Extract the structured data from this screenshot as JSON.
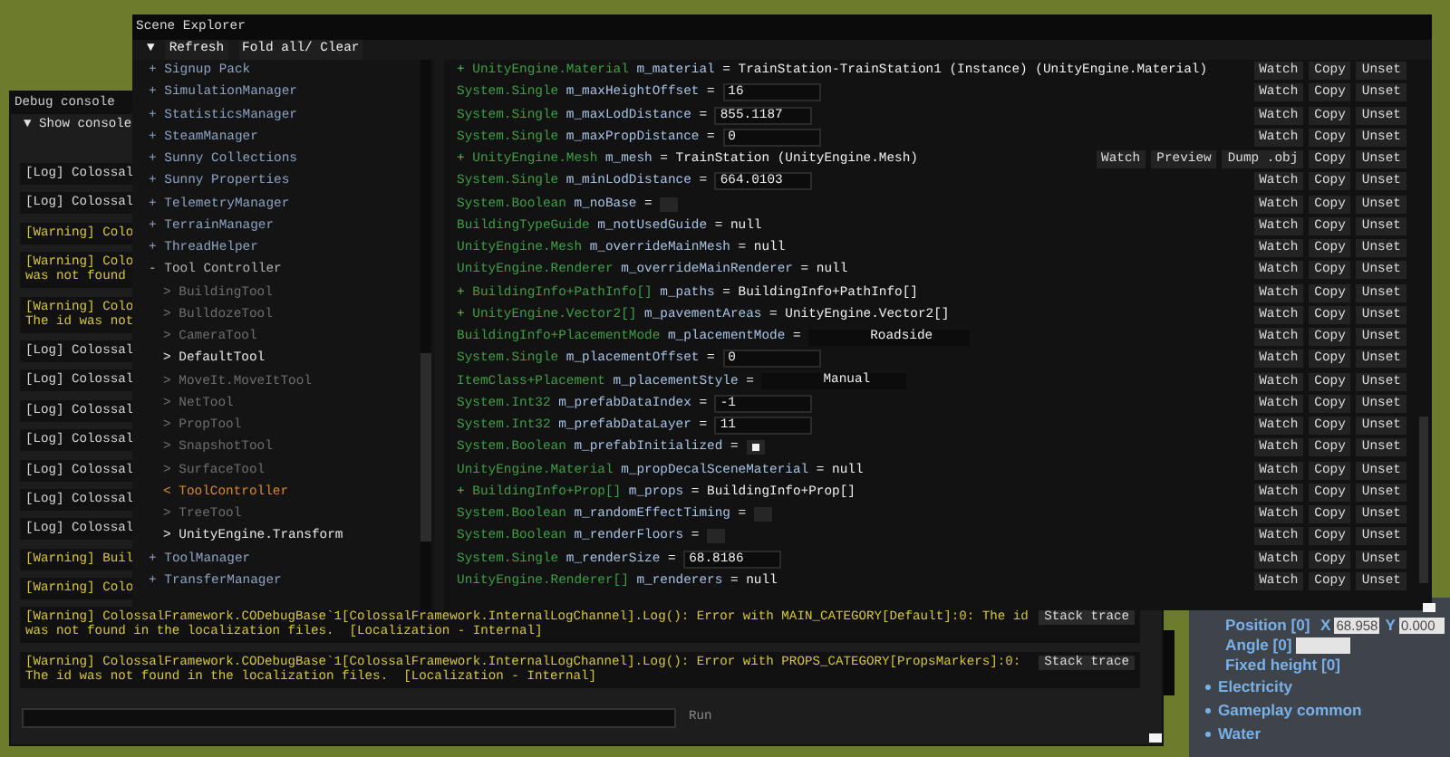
{
  "debug_console": {
    "title": "Debug console",
    "toggle": {
      "marker": "▼",
      "label": "Show console"
    },
    "entries": [
      {
        "kind": "log",
        "lines": [
          "[Log] Colossal"
        ]
      },
      {
        "kind": "log",
        "lines": [
          "[Log] Colossal"
        ]
      },
      {
        "kind": "warning",
        "lines": [
          "[Warning] Colo"
        ]
      },
      {
        "kind": "warning",
        "lines": [
          "[Warning] Colo",
          "was not found"
        ]
      },
      {
        "kind": "warning",
        "lines": [
          "[Warning] Colo",
          "The id was not"
        ]
      },
      {
        "kind": "log",
        "lines": [
          "[Log] Colossal"
        ]
      },
      {
        "kind": "log",
        "lines": [
          "[Log] Colossal"
        ]
      },
      {
        "kind": "log",
        "lines": [
          "[Log] Colossal"
        ]
      },
      {
        "kind": "log",
        "lines": [
          "[Log] Colossal"
        ]
      },
      {
        "kind": "log",
        "lines": [
          "[Log] Colossal"
        ]
      },
      {
        "kind": "log",
        "lines": [
          "[Log] Colossal"
        ]
      },
      {
        "kind": "log",
        "lines": [
          "[Log] Colossal"
        ]
      },
      {
        "kind": "warning",
        "lines": [
          "[Warning] Buil"
        ]
      },
      {
        "kind": "warning",
        "lines": [
          "[Warning] Colo"
        ]
      },
      {
        "kind": "warning",
        "lines": [
          "[Warning] ColossalFramework.CODebugBase`1[ColossalFramework.InternalLogChannel].Log(): Error with MAIN_CATEGORY[Default]:0: The id",
          "was not found in the localization files.  [Localization - Internal]"
        ],
        "action": "Stack trace"
      },
      {
        "kind": "warning",
        "lines": [
          "[Warning] ColossalFramework.CODebugBase`1[ColossalFramework.InternalLogChannel].Log(): Error with PROPS_CATEGORY[PropsMarkers]:0:",
          "The id was not found in the localization files.  [Localization - Internal]"
        ],
        "action": "Stack trace"
      }
    ],
    "run_button": "Run"
  },
  "scene_explorer": {
    "title": "Scene Explorer",
    "toolbar": {
      "marker": "▼",
      "buttons": [
        "Refresh",
        "Fold all/ Clear"
      ]
    },
    "tree": [
      {
        "marker": "+",
        "label": "Signup Pack"
      },
      {
        "marker": "+",
        "label": "SimulationManager"
      },
      {
        "marker": "+",
        "label": "StatisticsManager"
      },
      {
        "marker": "+",
        "label": "SteamManager"
      },
      {
        "marker": "+",
        "label": "Sunny Collections"
      },
      {
        "marker": "+",
        "label": "Sunny Properties"
      },
      {
        "marker": "+",
        "label": "TelemetryManager"
      },
      {
        "marker": "+",
        "label": "TerrainManager"
      },
      {
        "marker": "+",
        "label": "ThreadHelper"
      },
      {
        "marker": "-",
        "label": "Tool Controller",
        "children": [
          {
            "marker": ">",
            "label": "BuildingTool",
            "kind": "inactive"
          },
          {
            "marker": ">",
            "label": "BulldozeTool",
            "kind": "inactive"
          },
          {
            "marker": ">",
            "label": "CameraTool",
            "kind": "inactive"
          },
          {
            "marker": ">",
            "label": "DefaultTool",
            "kind": "active"
          },
          {
            "marker": ">",
            "label": "MoveIt.MoveItTool",
            "kind": "inactive"
          },
          {
            "marker": ">",
            "label": "NetTool",
            "kind": "inactive"
          },
          {
            "marker": ">",
            "label": "PropTool",
            "kind": "inactive"
          },
          {
            "marker": ">",
            "label": "SnapshotTool",
            "kind": "inactive"
          },
          {
            "marker": ">",
            "label": "SurfaceTool",
            "kind": "inactive"
          },
          {
            "marker": "<",
            "label": "ToolController",
            "kind": "current"
          },
          {
            "marker": ">",
            "label": "TreeTool",
            "kind": "inactive"
          },
          {
            "marker": ">",
            "label": "UnityEngine.Transform",
            "kind": "active"
          }
        ]
      },
      {
        "marker": "+",
        "label": "ToolManager"
      },
      {
        "marker": "+",
        "label": "TransferManager"
      }
    ],
    "properties": [
      {
        "kind": "text",
        "marker": "+",
        "type": "UnityEngine.Material",
        "name": "m_material",
        "sep": "=",
        "value": "TrainStation-TrainStation1 (Instance) (UnityEngine.Material)",
        "buttons": [
          "Watch",
          "Copy",
          "Unset"
        ]
      },
      {
        "kind": "field",
        "type": "System.Single",
        "name": "m_maxHeightOffset",
        "sep": "=",
        "value": "16",
        "buttons": [
          "Watch",
          "Copy",
          "Unset"
        ]
      },
      {
        "kind": "field",
        "type": "System.Single",
        "name": "m_maxLodDistance",
        "sep": "=",
        "value": "855.1187",
        "buttons": [
          "Watch",
          "Copy",
          "Unset"
        ]
      },
      {
        "kind": "field",
        "type": "System.Single",
        "name": "m_maxPropDistance",
        "sep": "=",
        "value": "0",
        "buttons": [
          "Watch",
          "Copy",
          "Unset"
        ]
      },
      {
        "kind": "text",
        "marker": "+",
        "type": "UnityEngine.Mesh",
        "name": "m_mesh",
        "sep": "=",
        "value": "TrainStation (UnityEngine.Mesh)",
        "buttons": [
          "Watch",
          "Preview",
          "Dump .obj",
          "Copy",
          "Unset"
        ]
      },
      {
        "kind": "field",
        "type": "System.Single",
        "name": "m_minLodDistance",
        "sep": "=",
        "value": "664.0103",
        "buttons": [
          "Watch",
          "Copy",
          "Unset"
        ]
      },
      {
        "kind": "toggle",
        "type": "System.Boolean",
        "name": "m_noBase",
        "sep": "=",
        "checked": false,
        "buttons": [
          "Watch",
          "Copy",
          "Unset"
        ]
      },
      {
        "kind": "text",
        "type": "BuildingTypeGuide",
        "name": "m_notUsedGuide",
        "sep": "=",
        "value": "null",
        "buttons": [
          "Watch",
          "Copy",
          "Unset"
        ]
      },
      {
        "kind": "text",
        "type": "UnityEngine.Mesh",
        "name": "m_overrideMainMesh",
        "sep": "=",
        "value": "null",
        "buttons": [
          "Watch",
          "Copy",
          "Unset"
        ]
      },
      {
        "kind": "text",
        "type": "UnityEngine.Renderer",
        "name": "m_overrideMainRenderer",
        "sep": "=",
        "value": "null",
        "buttons": [
          "Watch",
          "Copy",
          "Unset"
        ]
      },
      {
        "kind": "text",
        "marker": "+",
        "type": "BuildingInfo+PathInfo[]",
        "name": "m_paths",
        "sep": "=",
        "value": "BuildingInfo+PathInfo[]",
        "buttons": [
          "Watch",
          "Copy",
          "Unset"
        ]
      },
      {
        "kind": "text",
        "marker": "+",
        "type": "UnityEngine.Vector2[]",
        "name": "m_pavementAreas",
        "sep": "=",
        "value": "UnityEngine.Vector2[]",
        "buttons": [
          "Watch",
          "Copy",
          "Unset"
        ]
      },
      {
        "kind": "enum",
        "type": "BuildingInfo+PlacementMode",
        "name": "m_placementMode",
        "sep": "=",
        "value": "Roadside",
        "buttons": [
          "Watch",
          "Copy",
          "Unset"
        ]
      },
      {
        "kind": "field",
        "type": "System.Single",
        "name": "m_placementOffset",
        "sep": "=",
        "value": "0",
        "buttons": [
          "Watch",
          "Copy",
          "Unset"
        ]
      },
      {
        "kind": "enum",
        "type": "ItemClass+Placement",
        "name": "m_placementStyle",
        "sep": "=",
        "value": "Manual",
        "buttons": [
          "Watch",
          "Copy",
          "Unset"
        ]
      },
      {
        "kind": "field",
        "type": "System.Int32",
        "name": "m_prefabDataIndex",
        "sep": "=",
        "value": "-1",
        "buttons": [
          "Watch",
          "Copy",
          "Unset"
        ]
      },
      {
        "kind": "field",
        "type": "System.Int32",
        "name": "m_prefabDataLayer",
        "sep": "=",
        "value": "11",
        "buttons": [
          "Watch",
          "Copy",
          "Unset"
        ]
      },
      {
        "kind": "toggle",
        "type": "System.Boolean",
        "name": "m_prefabInitialized",
        "sep": "=",
        "checked": true,
        "buttons": [
          "Watch",
          "Copy",
          "Unset"
        ]
      },
      {
        "kind": "text",
        "type": "UnityEngine.Material",
        "name": "m_propDecalSceneMaterial",
        "sep": "=",
        "value": "null",
        "buttons": [
          "Watch",
          "Copy",
          "Unset"
        ]
      },
      {
        "kind": "text",
        "marker": "+",
        "type": "BuildingInfo+Prop[]",
        "name": "m_props",
        "sep": "=",
        "value": "BuildingInfo+Prop[]",
        "buttons": [
          "Watch",
          "Copy",
          "Unset"
        ]
      },
      {
        "kind": "toggle",
        "type": "System.Boolean",
        "name": "m_randomEffectTiming",
        "sep": "=",
        "checked": false,
        "buttons": [
          "Watch",
          "Copy",
          "Unset"
        ]
      },
      {
        "kind": "toggle",
        "type": "System.Boolean",
        "name": "m_renderFloors",
        "sep": "=",
        "checked": false,
        "buttons": [
          "Watch",
          "Copy",
          "Unset"
        ]
      },
      {
        "kind": "field",
        "type": "System.Single",
        "name": "m_renderSize",
        "sep": "=",
        "value": "68.8186",
        "buttons": [
          "Watch",
          "Copy",
          "Unset"
        ]
      },
      {
        "kind": "text",
        "type": "UnityEngine.Renderer[]",
        "name": "m_renderers",
        "sep": "=",
        "value": "null",
        "buttons": [
          "Watch",
          "Copy",
          "Unset"
        ]
      }
    ]
  },
  "game_panel": {
    "rows": [
      {
        "label": "Position [0]",
        "inputs": [
          {
            "axis": "X",
            "value": "68.958"
          },
          {
            "axis": "Y",
            "value": "0.000"
          }
        ]
      },
      {
        "label": "Angle [0]",
        "has_field": true
      },
      {
        "label": "Fixed height [0]"
      }
    ],
    "sections": [
      "Electricity",
      "Gameplay common",
      "Water"
    ]
  }
}
